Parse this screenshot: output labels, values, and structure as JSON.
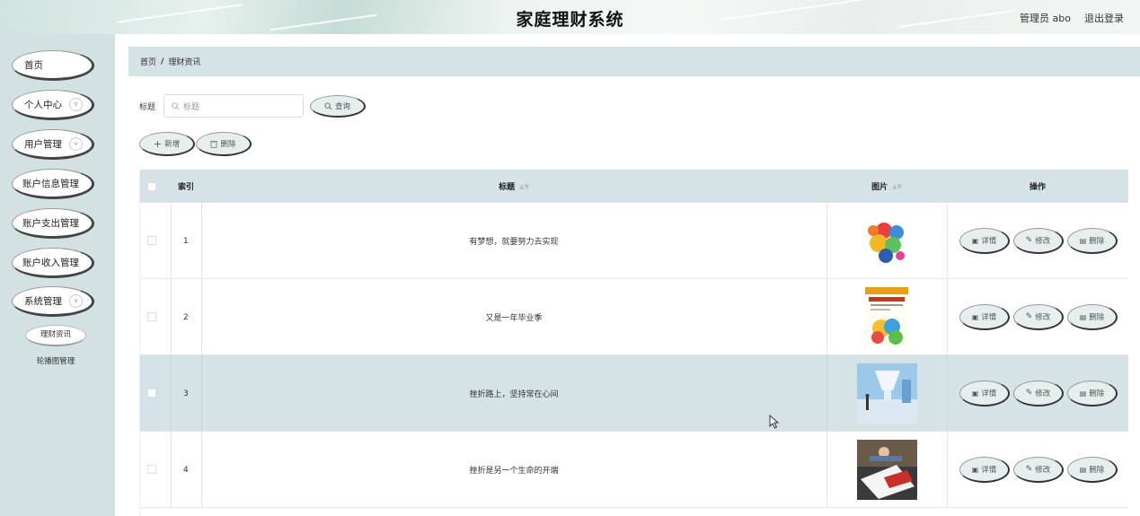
{
  "header": {
    "title": "家庭理财系统",
    "admin_label": "管理员 abo",
    "logout_label": "退出登录"
  },
  "sidebar": {
    "items": [
      {
        "label": "首页",
        "expandable": false
      },
      {
        "label": "个人中心",
        "expandable": true
      },
      {
        "label": "用户管理",
        "expandable": true
      },
      {
        "label": "账户信息管理",
        "expandable": false
      },
      {
        "label": "账户支出管理",
        "expandable": false
      },
      {
        "label": "账户收入管理",
        "expandable": false
      },
      {
        "label": "系统管理",
        "expandable": true
      }
    ],
    "submenu": [
      {
        "label": "理财资讯",
        "active": true
      },
      {
        "label": "轮播图管理",
        "active": false
      }
    ]
  },
  "breadcrumb": {
    "home": "首页",
    "separator": "/",
    "current": "理财资讯"
  },
  "search": {
    "label": "标题",
    "placeholder": "标题",
    "button_label": "查询"
  },
  "toolbar": {
    "add_label": "新增",
    "delete_label": "删除"
  },
  "table": {
    "headers": {
      "index": "索引",
      "title": "标题",
      "image": "图片",
      "actions": "操作"
    },
    "rows": [
      {
        "index": "1",
        "title": "有梦想，就要努力去实现",
        "image": "coins-collage-image",
        "highlighted": false
      },
      {
        "index": "2",
        "title": "又是一年毕业季",
        "image": "bank-book-cover-image",
        "highlighted": false
      },
      {
        "index": "3",
        "title": "挫折路上，坚持常在心间",
        "image": "business-hall-image",
        "highlighted": true
      },
      {
        "index": "4",
        "title": "挫折是另一个生命的开端",
        "image": "bank-card-image",
        "highlighted": false
      }
    ],
    "row_actions": {
      "detail": "详情",
      "edit": "修改",
      "delete": "删除"
    }
  },
  "colors": {
    "accent": "#d5e3e6",
    "sidebar_bg": "#d2e2e2"
  }
}
